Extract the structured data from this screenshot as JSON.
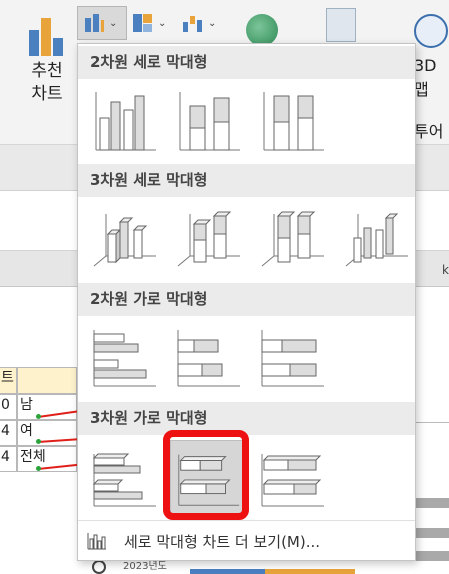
{
  "ribbon": {
    "recommended_label_line1": "추천",
    "recommended_label_line2": "차트",
    "map3d_label": "3D",
    "map_label": "맵",
    "tour_label": "투어"
  },
  "sheet": {
    "col_header_partial": "k",
    "header_cell": "트",
    "rows": [
      {
        "num": "0",
        "label": "남"
      },
      {
        "num": "4",
        "label": "여"
      },
      {
        "num": "4",
        "label": "전체"
      }
    ],
    "year_label": "2023년도"
  },
  "gallery": {
    "sections": [
      {
        "title": "2차원 세로 막대형"
      },
      {
        "title": "3차원 세로 막대형"
      },
      {
        "title": "2차원 가로 막대형"
      },
      {
        "title": "3차원 가로 막대형"
      }
    ],
    "more_link": "세로 막대형 차트 더 보기(M)..."
  },
  "colors": {
    "accent_red": "#ee1111",
    "hover_gray": "#d6d6d6",
    "section_header": "#ebebeb"
  }
}
